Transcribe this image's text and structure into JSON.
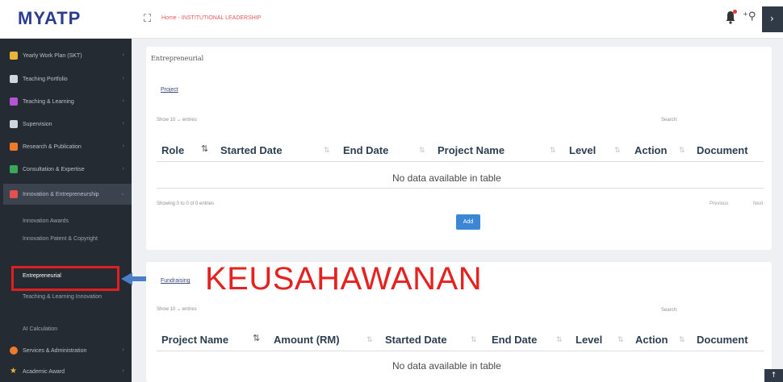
{
  "app": {
    "logo_text": "MYATP",
    "page_path": "Home - INSTITUTIONAL LEADERSHIP"
  },
  "topbar": {
    "menu_icon": "fullscreen-icon",
    "notification_icon": "bell-icon",
    "add_user_icon": "add-user-icon",
    "right_icon": "chevron-icon"
  },
  "sidebar": {
    "items": [
      {
        "label": "Yearly Work Plan (SKT)",
        "icon": "folder-icon",
        "color": "#e8b53a"
      },
      {
        "label": "Teaching Portfolio",
        "icon": "book-icon",
        "color": "#cfd6dd"
      },
      {
        "label": "Teaching & Learning",
        "icon": "pencil-icon",
        "color": "#b455d6"
      },
      {
        "label": "Supervision",
        "icon": "list-icon",
        "color": "#cfd6dd"
      },
      {
        "label": "Research & Publication",
        "icon": "document-icon",
        "color": "#ef7a2a"
      },
      {
        "label": "Consultation & Expertise",
        "icon": "grid-icon",
        "color": "#3aa85a"
      },
      {
        "label": "Innovation & Entrepreneurship",
        "icon": "flask-icon",
        "color": "#e25050"
      }
    ],
    "sub_items": [
      {
        "label": "Innovation Awards"
      },
      {
        "label": "Innovation Patent & Copyright"
      },
      {
        "label": "Entrepreneurial"
      },
      {
        "label": "Teaching & Learning Innovation"
      },
      {
        "label": "AI Calculation"
      }
    ],
    "bottom_items": [
      {
        "label": "Services & Administration",
        "icon": "gear-icon",
        "color": "#ef7a2a"
      },
      {
        "label": "Academic Award",
        "icon": "star-icon",
        "color": "#e8b53a"
      }
    ]
  },
  "card1": {
    "title": "Entrepreneurial",
    "section_link": "Project",
    "show_label": "Show  10  ⌄ entries",
    "search_label": "Search:",
    "columns": [
      "Role",
      "Started Date",
      "End Date",
      "Project Name",
      "Level",
      "Action",
      "Document"
    ],
    "empty_text": "No data available in table",
    "showing_text": "Showing 0 to 0 of 0 entries",
    "pager_prev": "Previous",
    "pager_next": "Next",
    "add_label": "Add"
  },
  "card2": {
    "section_link": "Fundraising",
    "show_label": "Show  10  ⌄ entries",
    "search_label": "Search:",
    "columns": [
      "Project Name",
      "Amount (RM)",
      "Started Date",
      "End Date",
      "Level",
      "Action",
      "Document"
    ],
    "empty_text": "No data available in table"
  },
  "annotation": {
    "text": "KEUSAHAWANAN",
    "color": "#e5221f"
  }
}
